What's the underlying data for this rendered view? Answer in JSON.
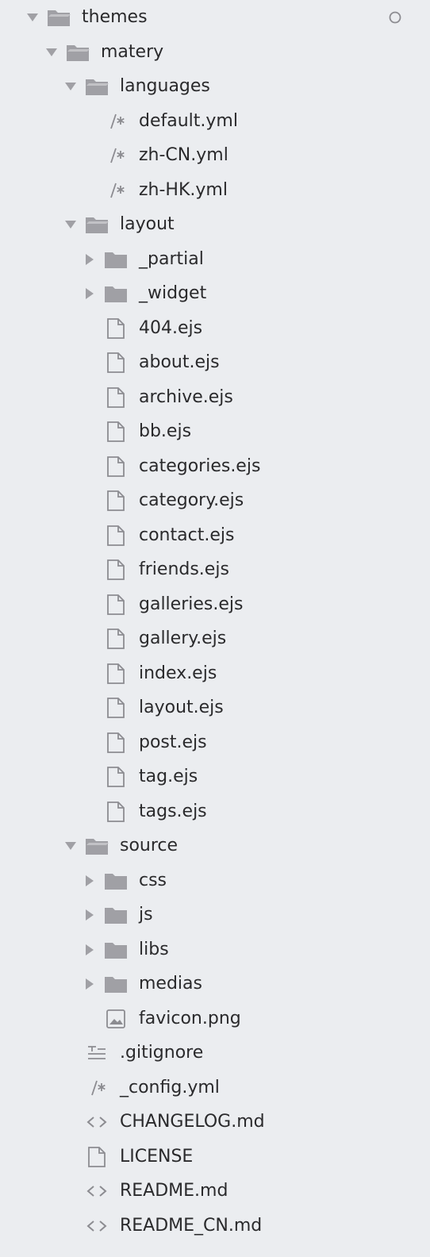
{
  "colors": {
    "background": "#ebedf0",
    "text": "#2a2a2c",
    "icon": "#a0a0a5",
    "icon_stroke": "#8c8c91"
  },
  "tree": [
    {
      "name": "themes",
      "kind": "folder-open",
      "depth": 0,
      "status": "modified-dot"
    },
    {
      "name": "matery",
      "kind": "folder-open",
      "depth": 1
    },
    {
      "name": "languages",
      "kind": "folder-open",
      "depth": 2
    },
    {
      "name": "default.yml",
      "kind": "comment",
      "depth": 3
    },
    {
      "name": "zh-CN.yml",
      "kind": "comment",
      "depth": 3
    },
    {
      "name": "zh-HK.yml",
      "kind": "comment",
      "depth": 3
    },
    {
      "name": "layout",
      "kind": "folder-open",
      "depth": 2
    },
    {
      "name": "_partial",
      "kind": "folder-closed",
      "depth": 3
    },
    {
      "name": "_widget",
      "kind": "folder-closed",
      "depth": 3
    },
    {
      "name": "404.ejs",
      "kind": "file",
      "depth": 3
    },
    {
      "name": "about.ejs",
      "kind": "file",
      "depth": 3
    },
    {
      "name": "archive.ejs",
      "kind": "file",
      "depth": 3
    },
    {
      "name": "bb.ejs",
      "kind": "file",
      "depth": 3
    },
    {
      "name": "categories.ejs",
      "kind": "file",
      "depth": 3
    },
    {
      "name": "category.ejs",
      "kind": "file",
      "depth": 3
    },
    {
      "name": "contact.ejs",
      "kind": "file",
      "depth": 3
    },
    {
      "name": "friends.ejs",
      "kind": "file",
      "depth": 3
    },
    {
      "name": "galleries.ejs",
      "kind": "file",
      "depth": 3
    },
    {
      "name": "gallery.ejs",
      "kind": "file",
      "depth": 3
    },
    {
      "name": "index.ejs",
      "kind": "file",
      "depth": 3
    },
    {
      "name": "layout.ejs",
      "kind": "file",
      "depth": 3
    },
    {
      "name": "post.ejs",
      "kind": "file",
      "depth": 3
    },
    {
      "name": "tag.ejs",
      "kind": "file",
      "depth": 3
    },
    {
      "name": "tags.ejs",
      "kind": "file",
      "depth": 3
    },
    {
      "name": "source",
      "kind": "folder-open",
      "depth": 2
    },
    {
      "name": "css",
      "kind": "folder-closed",
      "depth": 3
    },
    {
      "name": "js",
      "kind": "folder-closed",
      "depth": 3
    },
    {
      "name": "libs",
      "kind": "folder-closed",
      "depth": 3
    },
    {
      "name": "medias",
      "kind": "folder-closed",
      "depth": 3
    },
    {
      "name": "favicon.png",
      "kind": "image",
      "depth": 3
    },
    {
      "name": ".gitignore",
      "kind": "text-lines",
      "depth": 2
    },
    {
      "name": "_config.yml",
      "kind": "comment",
      "depth": 2
    },
    {
      "name": "CHANGELOG.md",
      "kind": "code",
      "depth": 2
    },
    {
      "name": "LICENSE",
      "kind": "file",
      "depth": 2
    },
    {
      "name": "README.md",
      "kind": "code",
      "depth": 2
    },
    {
      "name": "README_CN.md",
      "kind": "code",
      "depth": 2
    }
  ]
}
